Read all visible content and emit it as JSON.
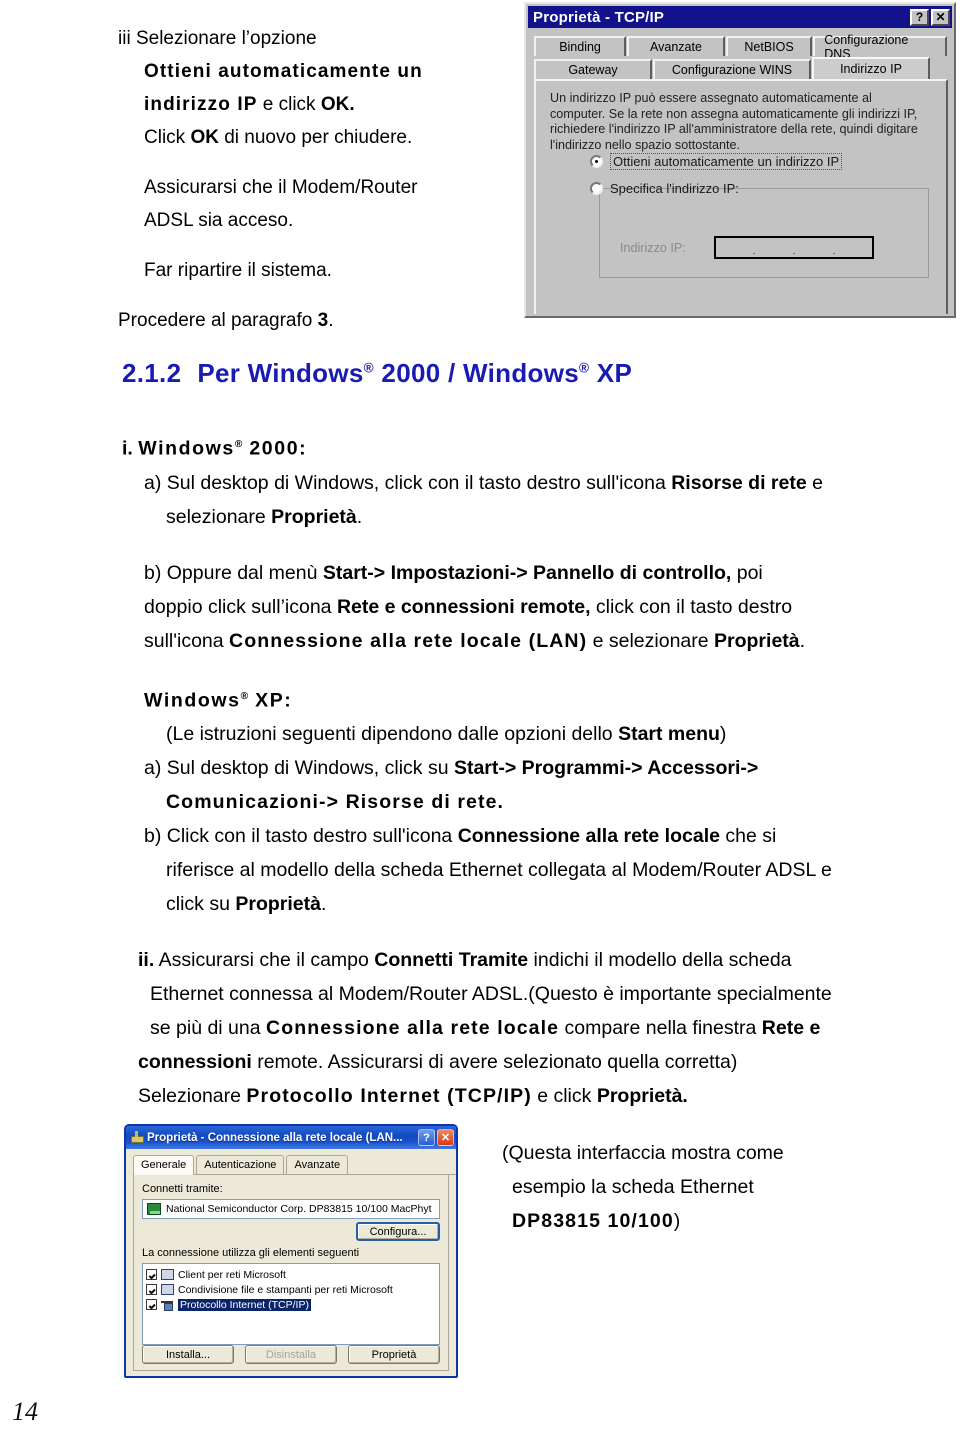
{
  "intro": {
    "lines": [
      {
        "marker": "iii",
        "text": "Selezionare l’opzione"
      },
      {
        "bold": true,
        "text": "Ottieni  automaticamente  un"
      },
      {
        "mixed": true,
        "text": "indirizzo IP e click OK."
      },
      {
        "text": "Click OK di nuovo per chiudere."
      },
      {
        "text": "Assicurarsi che il Modem/Router"
      },
      {
        "text": "ADSL sia acceso."
      },
      {
        "text": "Far ripartire il sistema."
      },
      {
        "text": "Procedere al paragrafo 3."
      }
    ],
    "l1_marker": "iii",
    "l1_rest": "Selezionare l’opzione",
    "l2": "Ottieni  automaticamente  un",
    "l3_bold_a": "indirizzo IP",
    "l3_plain": " e click ",
    "l3_bold_b": "OK.",
    "l4_a": "Click ",
    "l4_b": "OK",
    "l4_c": " di nuovo per chiudere.",
    "l5": "Assicurarsi che il Modem/Router",
    "l6": "ADSL sia acceso.",
    "l7": "Far ripartire il sistema.",
    "l8_a": "Procedere al paragrafo ",
    "l8_b": "3",
    "l8_c": "."
  },
  "tcpip_dialog": {
    "title": "Proprietà - TCP/IP",
    "help_button": "?",
    "close_button": "✕",
    "tabs_row1": [
      "Binding",
      "Avanzate",
      "NetBIOS",
      "Configurazione DNS"
    ],
    "tabs_row2": [
      "Gateway",
      "Configurazione WINS",
      "Indirizzo IP"
    ],
    "selected_tab": "Indirizzo IP",
    "description": "Un indirizzo IP può essere assegnato automaticamente al computer. Se la rete non assegna automaticamente gli indirizzi IP, richiedere l'indirizzo IP all'amministratore della rete, quindi digitare l'indirizzo nello spazio sottostante.",
    "radio_auto": "Ottieni automaticamente un indirizzo IP",
    "radio_auto_selected": true,
    "radio_specific": "Specifica l'indirizzo IP:",
    "radio_specific_selected": false,
    "ip_label": "Indirizzo IP:",
    "ip_value": "",
    "ip_separator": "."
  },
  "section": {
    "number": "2.1.2",
    "title_a": "Per Windows",
    "title_b": " 2000 / Windows",
    "title_c": " XP",
    "reg": "®"
  },
  "body": {
    "win2000_marker": "i.",
    "win2000_label_a": "Windows",
    "win2000_label_b": " 2000:",
    "a_line1_a": "a) Sul desktop di Windows, click con il tasto destro sull'icona ",
    "a_line1_b": "Risorse di rete",
    "a_line1_c": " e",
    "a_line2_a": "selezionare ",
    "a_line2_b": "Proprietà",
    "a_line2_c": ".",
    "b_line1_a": "b) Oppure dal menù ",
    "b_line1_b": "Start-> Impostazioni-> Pannello di controllo,",
    "b_line1_c": " poi",
    "b_line2_a": "doppio click sull’icona ",
    "b_line2_b": "Rete e connessioni remote,",
    "b_line2_c": " click con il tasto destro",
    "b_line3_a": "sull'icona ",
    "b_line3_b": "Connessione alla rete locale (LAN)",
    "b_line3_c": " e selezionare ",
    "b_line3_d": "Proprietà",
    "b_line3_e": ".",
    "winxp_label_a": "Windows",
    "winxp_label_b": " XP:",
    "xp_note_a": "(Le istruzioni seguenti dipendono dalle opzioni dello ",
    "xp_note_b": "Start menu",
    "xp_note_c": ")",
    "xp_a_line1_a": "a) Sul desktop di Windows, click su ",
    "xp_a_line1_b": "Start-> Programmi-> Accessori->",
    "xp_a_line2": "Comunicazioni-> Risorse di rete.",
    "xp_b_line1_a": "b) Click con il tasto destro sull'icona ",
    "xp_b_line1_b": "Connessione alla rete locale",
    "xp_b_line1_c": " che si",
    "xp_b_line2": "riferisce al modello della scheda Ethernet collegata al Modem/Router ADSL e",
    "xp_b_line3_a": "click su ",
    "xp_b_line3_b": "Proprietà",
    "xp_b_line3_c": ".",
    "ii_marker": "ii.",
    "ii_line1_a": " Assicurarsi che il campo ",
    "ii_line1_b": "Connetti Tramite",
    "ii_line1_c": " indichi il modello della scheda",
    "ii_line2": "Ethernet connessa al Modem/Router ADSL.(Questo è importante specialmente",
    "ii_line3_a": "se più di una ",
    "ii_line3_b": "Connessione alla rete locale",
    "ii_line3_c": " compare nella finestra ",
    "ii_line3_d": "Rete e",
    "ii_line4_a": "connessioni",
    "ii_line4_b": " remote. Assicurarsi di avere selezionato quella corretta)",
    "ii_line5_a": "Selezionare ",
    "ii_line5_b": "Protocollo Internet (TCP/IP)",
    "ii_line5_c": " e click ",
    "ii_line5_d": "Proprietà."
  },
  "lan_dialog": {
    "title": "Proprietà - Connessione alla rete locale (LAN...",
    "help_button": "?",
    "close_button": "✕",
    "tabs": [
      "Generale",
      "Autenticazione",
      "Avanzate"
    ],
    "selected_tab": "Generale",
    "connect_using_label": "Connetti tramite:",
    "adapter_name": "National Semiconductor Corp. DP83815 10/100 MacPhyt",
    "configure_button": "Configura...",
    "components_label": "La connessione utilizza gli elementi seguenti",
    "components": [
      {
        "label": "Client per reti Microsoft",
        "checked": true,
        "selected": false
      },
      {
        "label": "Condivisione file e stampanti per reti Microsoft",
        "checked": true,
        "selected": false
      },
      {
        "label": "Protocollo Internet (TCP/IP)",
        "checked": true,
        "selected": true
      }
    ],
    "install_button": "Installa...",
    "uninstall_button": "Disinstalla",
    "properties_button": "Proprietà"
  },
  "caption": {
    "line1": "(Questa interfaccia mostra come",
    "line2": "esempio la scheda Ethernet",
    "line3_bold": "DP83815 10/100",
    "line3_tail": ")"
  },
  "page_number": "14",
  "colors": {
    "heading_blue": "#1a1ab4",
    "win98_face": "#c3c3c3",
    "win98_title": "#12128c",
    "xp_face": "#ece9d8",
    "xp_title": "#1049c0",
    "selection_blue": "#0a246a"
  }
}
